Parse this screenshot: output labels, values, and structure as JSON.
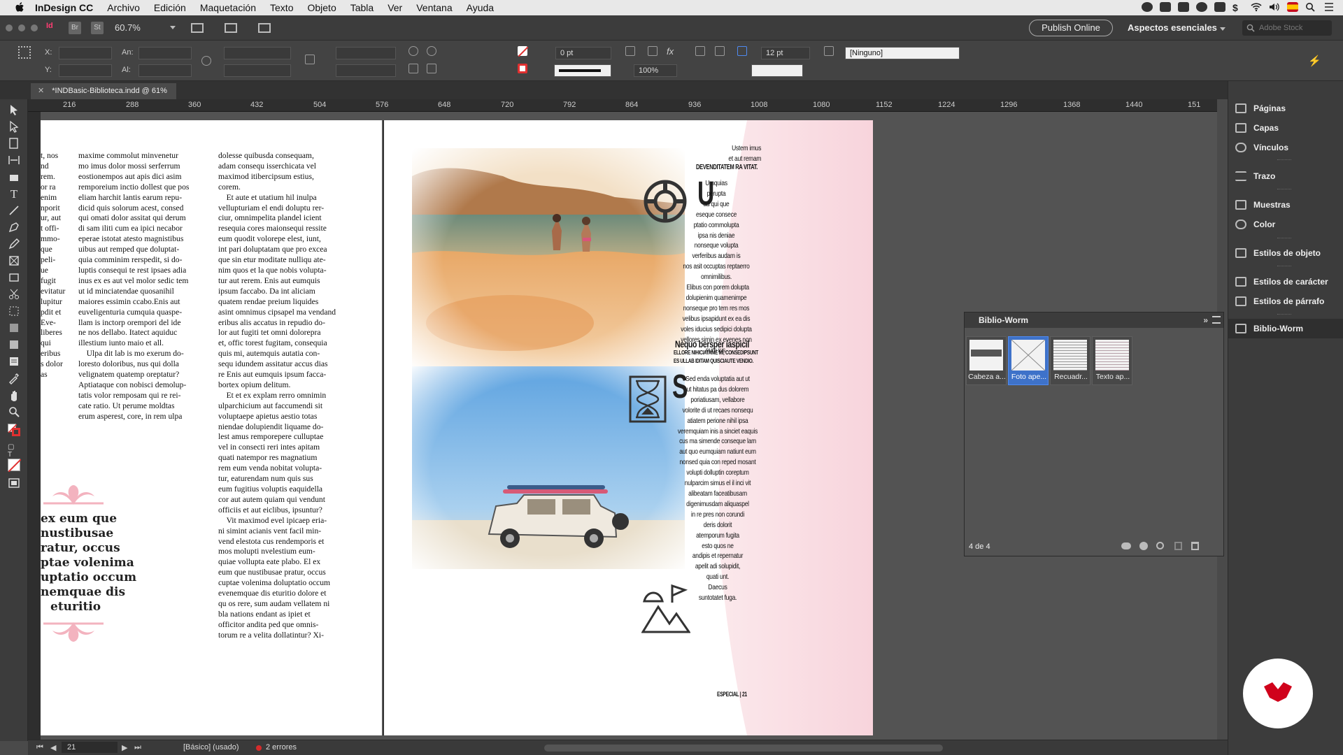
{
  "menubar": {
    "app": "InDesign CC",
    "items": [
      "Archivo",
      "Edición",
      "Maquetación",
      "Texto",
      "Objeto",
      "Tabla",
      "Ver",
      "Ventana",
      "Ayuda"
    ]
  },
  "appbar": {
    "bridge": "Br",
    "stock": "St",
    "zoom": "60.7%",
    "publish": "Publish Online",
    "workspace": "Aspectos esenciales",
    "search_placeholder": "Adobe Stock"
  },
  "control": {
    "x_label": "X:",
    "y_label": "Y:",
    "w_label": "An:",
    "h_label": "Al:",
    "stroke_weight": "0 pt",
    "scale": "100%",
    "gutter": "12 pt",
    "style": "[Ninguno]"
  },
  "tab": {
    "title": "*INDBasic-Biblioteca.indd @ 61%"
  },
  "ruler": [
    "216",
    "288",
    "360",
    "432",
    "504",
    "576",
    "648",
    "720",
    "792",
    "864",
    "936",
    "1008",
    "1080",
    "1152",
    "1224",
    "1296",
    "1368",
    "1440",
    "151"
  ],
  "left_page": {
    "margin_words": "t, nos\nnd\nrem.\nor ra\nenim\nnporit\nur, aut\nt offi-\nmmo-\nque\npeli-\nue\nfugit\nevitatur\nlupitur\npdit et\nEve-\nliberes\nqui\neribus\ns dolor\nas",
    "col1": "maxime commolut minvenetur\nmo imus dolor mossi serferrum\neostionempos aut apis dici asim\nremporeium inctio dollest que pos\neliam harchit lantis earum repu-\ndicid quis solorum acest, consed\nqui omati dolor assitat qui derum\ndi sam iliti cum ea ipici necabor\neperae istotat atesto magnistibus\nuibus aut remped que doluptat-\nquia comminim rerspedit, si do-\nluptis consequi te rest ipsaes adia\ninus ex es aut vel molor sedic tem\nut id minciatendae quosanihil\nmaiores essimin ccabo.Enis aut\neuveligenturia cumquia quaspe-\nllam is inctorp orempori del ide\nne nos dellabo. Itatect aquiduc\nillestium iunto maio et all.\n    Ulpa dit lab is mo exerum do-\nloresto doloribus, nus qui dolla\nvelignatem quatemp oreptatur?\nAptiataque con nobisci demolup-\ntatis volor remposam qui re rei-\ncate ratio. Ut perume moldtas\nerum asperest, core, in rem ulpa",
    "col2": "dolesse quibusda consequam,\nadam consequ isserchicata vel\nmaximod itibercipsum estius,\ncorem.\n    Et aute et utatium hil inulpa\nvellupturiam el endi doluptu rer-\nciur, omnimpelita plandel icient\nresequia cores maionsequi ressite\neum quodit volorepe elest, iunt,\nint pari doluptatam que pro excea\nque sin etur moditate nulliqu ate-\nnim quos et la que nobis volupta-\ntur aut rerem. Enis aut eumquis\nipsum faccabo. Da int aliciam\nquatem rendae preium liquides\nasint omnimus cipsapel ma vendand\neribus alis accatus in repudio do-\nlor aut fugiti tet omni doloreprа\net, offic torest fugitam, consequia\nquis mi, autemquis autatia con-\nsequ idundem assitatur accus dias\nre Enis aut eumquis ipsum facca-\nbortex opium delitum.\n    Et et ex explam rerro omnimin\nulparchicium aut faccumendi sit\nvoluptaepe apietus aestio totas\nniendae dolupiendit liquame do-\nlest amus remporepere culluptae\nvel in consecti reri intes apitam\nquati natempor res magnatium\nrem eum venda nobitat volupta-\ntur, eaturendam num quis sus\neum fugitius voluptis eaquidella\ncor aut autem quiam qui vendunt\nofficiis et aut eiclibus, ipsuntur?\n    Vit maximod evel ipicaep eria-\nni simint acianis vent facil min-\nvend elestota cus rendemporis et\nmos molupti nvelestium eum-\nquiae vollupta eate plabo. El ex\neum que nustibusae pratur, occus\ncuptae volenima doluptatio occum\nevenemquae dis eturitio dolore et\nqu os rere, sum audam vellatem ni\nbla nations endant as ipiet et\nofficitor andita ped que omnis-\ntorum re a velita dollatintur? Xi-",
    "pull_quote": [
      "ex eum que",
      "nustibusae",
      "ratur, occus",
      "ptae volenima",
      "uptatio occum",
      "nemquae dis",
      "eturitio"
    ]
  },
  "right_page": {
    "intro": "Ustem imus\net aut remam",
    "intro_caps": "DEVENDITATEM RA VITAT.",
    "text1": "Umquias\nperupta\nad qui que\neseque consece\nptatio commolupta\nipsa nis deniae\nnonseque volupta\nverferibus audam is\nnos asit occuptas reptaerro\nomnimilibus.\n  Elibus con porem dolupta\ndolupienim quamenimpe\nnonseque pro tem res mos\nvelibus ipsapidunt ex ea dis\nvoles iducius sedipici dolupta\nvellores simin ex evenes non\nnum ius.",
    "heading2": "Nequo bersper iaspicil",
    "heading2_sub": "ELLORE NIHICIATAME MI, CONSEDIPSUNT\nES ULLAB IDITAM QUISCIAUTE VENDIO.",
    "text2": "Sed enda voluptatia aut ut\nut hitatus pa dus dolorem\nporiatiusam, vellabore\nvolorite di ut recaes nonsequ\natiatem perione nihil ipsa\nveremquiam inis a sinciet eaquis\ncus ma simende conseque lam\naut quo eumquiam natiunt eum\nnonsed quia con reped mosant\nvolupti dolluptin coreptum\nnulparcim simus el il inci vit\nalibeatam faceatibusam\ndigenimusdam aliquaspel\nin re pres non corundi\nderis dolorit\natemporum fugita\nesto quos ne\nandipis et repernatur\napelit adi solupidit,\nquati unt.\nDaecus\nsuntotatet fuga.",
    "folio": "ESPECIAL | 21"
  },
  "dock": [
    "Páginas",
    "Capas",
    "Vínculos",
    "Trazo",
    "Muestras",
    "Color",
    "Estilos de objeto",
    "Estilos de carácter",
    "Estilos de párrafo",
    "Biblio-Worm"
  ],
  "library": {
    "title": "Biblio-Worm",
    "items": [
      "Cabeza a...",
      "Foto ape...",
      "Recuadr...",
      "Texto ap..."
    ],
    "count": "4 de 4"
  },
  "status": {
    "page": "21",
    "master": "[Básico] (usado)",
    "errors": "2 errores"
  },
  "colors": {
    "accent": "#3e72c9",
    "error": "#d62b2b",
    "pink": "#f8dde3",
    "brand": "#d0021b"
  }
}
